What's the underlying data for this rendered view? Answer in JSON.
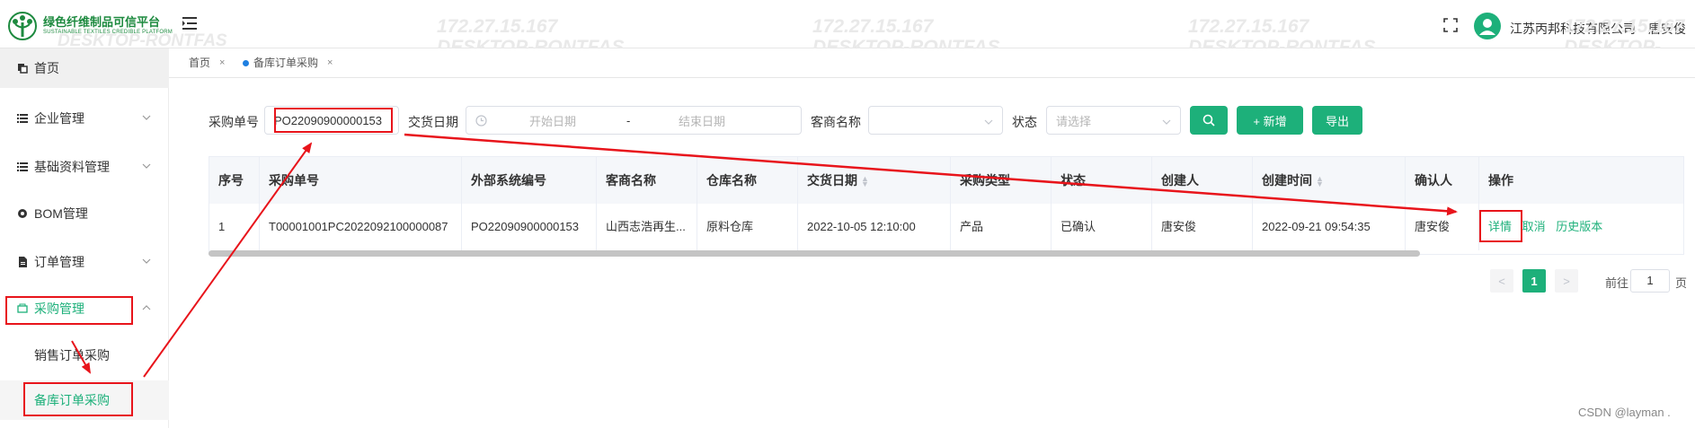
{
  "header": {
    "logo_cn": "绿色纤维制品可信平台",
    "logo_en": "SUSTAINABLE TEXTILES CREDIBLE PLATFORM",
    "company": "江苏丙邦科技有限公司",
    "username": "唐安俊",
    "watermark_ip": "172.27.15.167",
    "watermark_host": "DESKTOP-RONTFAS"
  },
  "sidebar": {
    "items": [
      {
        "label": "首页",
        "icon": "home-copy-icon"
      },
      {
        "label": "企业管理",
        "icon": "list-icon"
      },
      {
        "label": "基础资料管理",
        "icon": "list-icon"
      },
      {
        "label": "BOM管理",
        "icon": "bom-icon"
      },
      {
        "label": "订单管理",
        "icon": "document-icon"
      },
      {
        "label": "采购管理",
        "icon": "purchase-icon"
      }
    ],
    "sub_items": [
      {
        "label": "销售订单采购"
      },
      {
        "label": "备库订单采购"
      }
    ]
  },
  "tags": [
    {
      "label": "首页",
      "close": "×"
    },
    {
      "label": "备库订单采购",
      "close": "×"
    }
  ],
  "filters": {
    "po_label": "采购单号",
    "po_value": "PO22090900000153",
    "date_label": "交货日期",
    "start_placeholder": "开始日期",
    "date_sep": "-",
    "end_placeholder": "结束日期",
    "vendor_label": "客商名称",
    "status_label": "状态",
    "status_placeholder": "请选择",
    "add_label": "+ 新增",
    "export_label": "导出"
  },
  "table": {
    "columns": [
      "序号",
      "采购单号",
      "外部系统编号",
      "客商名称",
      "仓库名称",
      "交货日期",
      "采购类型",
      "状态",
      "创建人",
      "创建时间",
      "确认人",
      "操作"
    ],
    "rows": [
      {
        "index": "1",
        "po_no": "T00001001PC2022092100000087",
        "ext_no": "PO22090900000153",
        "vendor": "山西志浩再生...",
        "warehouse": "原料仓库",
        "delivery_date": "2022-10-05 12:10:00",
        "type": "产品",
        "status": "已确认",
        "creator": "唐安俊",
        "created_at": "2022-09-21 09:54:35",
        "confirmer": "唐安俊",
        "actions": [
          "详情",
          "取消",
          "历史版本"
        ]
      }
    ]
  },
  "pagination": {
    "current": "1",
    "goto_label": "前往",
    "goto_value": "1",
    "page_suffix": "页",
    "prev": "<",
    "next": ">"
  },
  "footer": {
    "credit": "CSDN @layman ."
  },
  "colors": {
    "accent": "#1db07a",
    "annotation": "#e8141b"
  }
}
